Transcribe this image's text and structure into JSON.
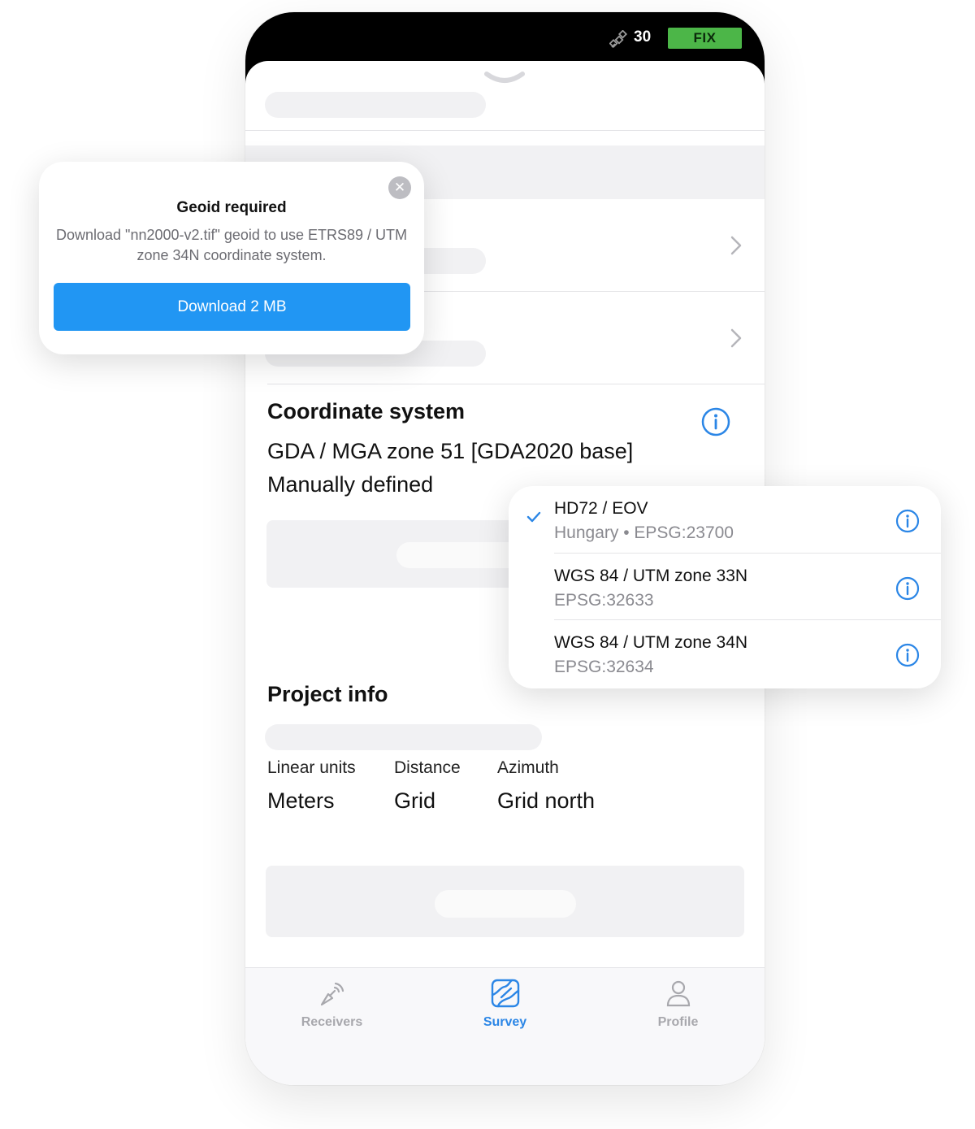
{
  "status": {
    "satellites": "30",
    "fix": "FIX"
  },
  "coordinate_system": {
    "title": "Coordinate system",
    "value": "GDA / MGA zone 51 [GDA2020 base]",
    "source": "Manually defined"
  },
  "project_info": {
    "title": "Project info",
    "columns": [
      {
        "label": "Linear units",
        "value": "Meters"
      },
      {
        "label": "Distance",
        "value": "Grid"
      },
      {
        "label": "Azimuth",
        "value": "Grid north"
      }
    ]
  },
  "tabs": [
    {
      "label": "Receivers",
      "icon": "antenna-icon",
      "active": false
    },
    {
      "label": "Survey",
      "icon": "map-icon",
      "active": true
    },
    {
      "label": "Profile",
      "icon": "person-icon",
      "active": false
    }
  ],
  "geoid_popup": {
    "title": "Geoid required",
    "message": "Download \"nn2000-v2.tif\" geoid to use ETRS89 / UTM zone 34N coordinate system.",
    "button": "Download 2 MB",
    "close_icon": "close-icon"
  },
  "cs_dropdown": {
    "items": [
      {
        "name": "HD72 / EOV",
        "subtitle": "Hungary • EPSG:23700",
        "selected": true
      },
      {
        "name": "WGS 84 / UTM zone 33N",
        "subtitle": "EPSG:32633",
        "selected": false
      },
      {
        "name": "WGS 84 / UTM zone 34N",
        "subtitle": "EPSG:32634",
        "selected": false
      }
    ]
  },
  "colors": {
    "accent": "#2b86e6",
    "button": "#2196f3",
    "fix": "#4cb648"
  }
}
